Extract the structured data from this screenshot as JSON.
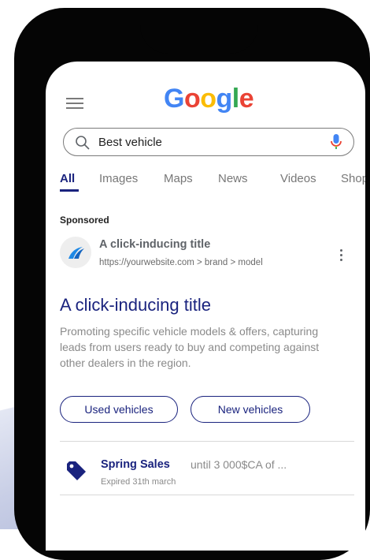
{
  "google": {
    "logo_letters": [
      {
        "char": "G",
        "color": "#4285F4"
      },
      {
        "char": "o",
        "color": "#EA4335"
      },
      {
        "char": "o",
        "color": "#FBBC05"
      },
      {
        "char": "g",
        "color": "#4285F4"
      },
      {
        "char": "l",
        "color": "#34A853"
      },
      {
        "char": "e",
        "color": "#EA4335"
      }
    ]
  },
  "search": {
    "query": "Best vehicle"
  },
  "tabs": [
    "All",
    "Images",
    "Maps",
    "News",
    "Videos",
    "Shoppi"
  ],
  "ad": {
    "label": "Sponsored",
    "site_title": "A click-inducing title",
    "url": "https://yourwebsite.com > brand > model",
    "headline": "A click-inducing title",
    "description": "Promoting specific vehicle models & offers, capturing leads from users ready to buy and competing against other dealers in the region.",
    "sitelinks": [
      "Used vehicles",
      "New vehicles"
    ],
    "promotion": {
      "title": "Spring Sales",
      "detail": "until 3 000$CA of ...",
      "expiry": "Expired 31th march"
    }
  },
  "colors": {
    "accent": "#1a237e",
    "muted": "#8a8a8a",
    "brand_blue": "#4285F4"
  },
  "icons": [
    "menu-icon",
    "search-icon",
    "mic-icon",
    "more-vert-icon",
    "tag-icon",
    "favicon-logo"
  ]
}
